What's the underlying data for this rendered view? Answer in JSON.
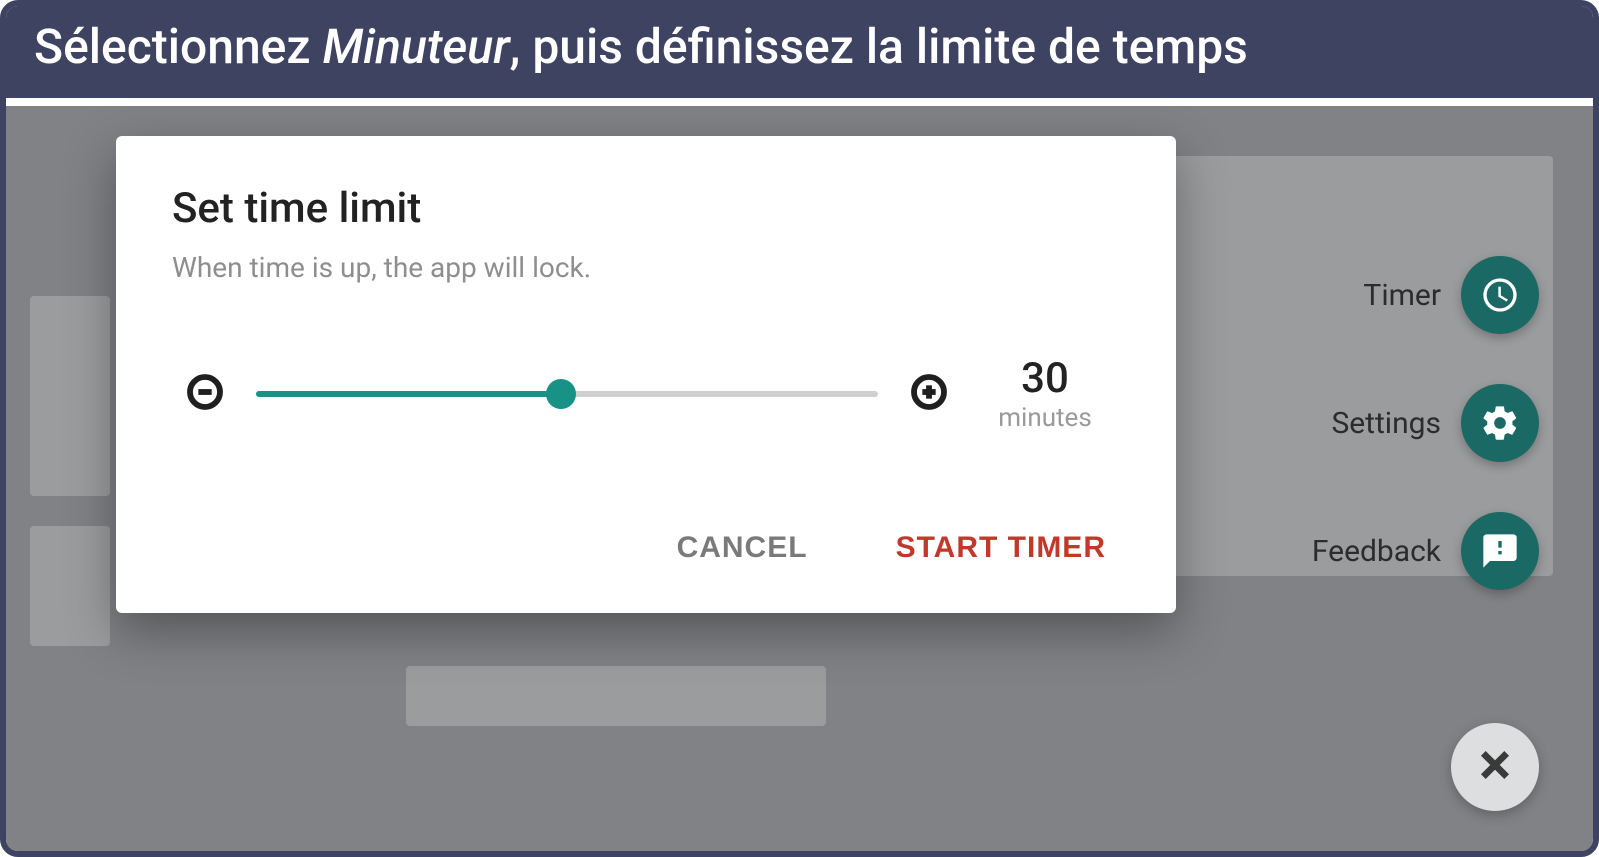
{
  "caption": {
    "prefix": "Sélectionnez ",
    "em": "Minuteur",
    "suffix": ", puis définissez la limite de temps"
  },
  "dialog": {
    "title": "Set time limit",
    "subtitle": "When time is up, the app will lock.",
    "value": "30",
    "unit": "minutes",
    "slider_percent": 49,
    "cancel": "CANCEL",
    "start": "START TIMER"
  },
  "fabs": {
    "timer": "Timer",
    "settings": "Settings",
    "feedback": "Feedback"
  }
}
